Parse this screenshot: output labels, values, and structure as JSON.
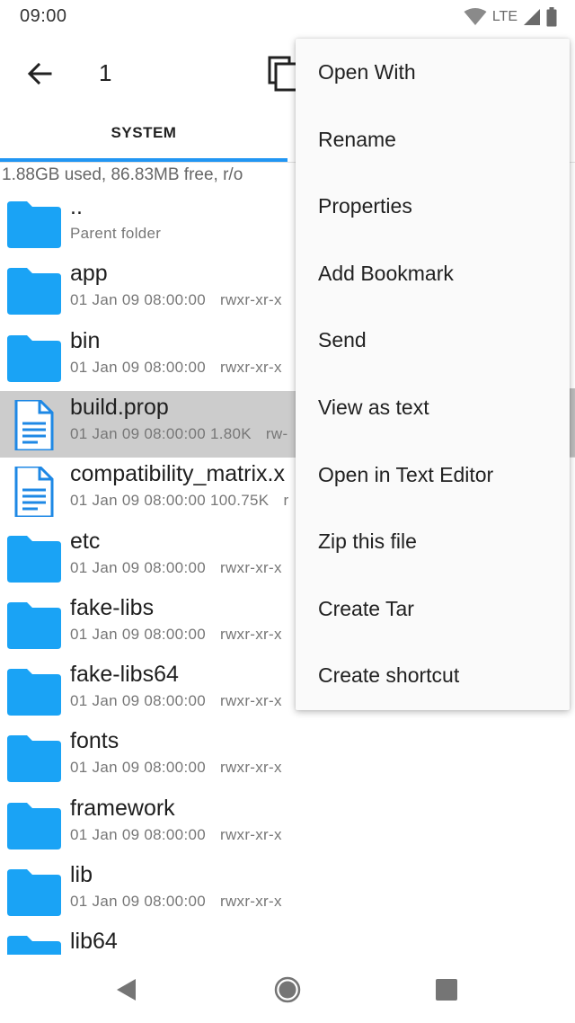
{
  "status_bar": {
    "time": "09:00",
    "network": "LTE",
    "icons": [
      "wifi-icon",
      "cell-signal-icon",
      "battery-icon"
    ]
  },
  "app_bar": {
    "title": "1",
    "back_icon": "arrow-back-icon",
    "copy_icon": "copy-icon"
  },
  "tabs": [
    {
      "label": "SYSTEM",
      "active": true
    }
  ],
  "storage_info": "1.88GB used, 86.83MB free, r/o",
  "colors": {
    "accent": "#2196f3",
    "folder": "#1aa3f5",
    "selected_row": "#cccccc"
  },
  "files": [
    {
      "name": "..",
      "meta": "Parent folder",
      "perm": "",
      "type": "folder",
      "selected": false
    },
    {
      "name": "app",
      "meta": "01 Jan 09 08:00:00",
      "perm": "rwxr-xr-x",
      "type": "folder",
      "selected": false
    },
    {
      "name": "bin",
      "meta": "01 Jan 09 08:00:00",
      "perm": "rwxr-xr-x",
      "type": "folder",
      "selected": false
    },
    {
      "name": "build.prop",
      "meta": "01 Jan 09 08:00:00  1.80K",
      "perm": "rw-",
      "type": "file",
      "selected": true
    },
    {
      "name": "compatibility_matrix.x",
      "meta": "01 Jan 09 08:00:00  100.75K",
      "perm": "r",
      "type": "file",
      "selected": false
    },
    {
      "name": "etc",
      "meta": "01 Jan 09 08:00:00",
      "perm": "rwxr-xr-x",
      "type": "folder",
      "selected": false
    },
    {
      "name": "fake-libs",
      "meta": "01 Jan 09 08:00:00",
      "perm": "rwxr-xr-x",
      "type": "folder",
      "selected": false
    },
    {
      "name": "fake-libs64",
      "meta": "01 Jan 09 08:00:00",
      "perm": "rwxr-xr-x",
      "type": "folder",
      "selected": false
    },
    {
      "name": "fonts",
      "meta": "01 Jan 09 08:00:00",
      "perm": "rwxr-xr-x",
      "type": "folder",
      "selected": false
    },
    {
      "name": "framework",
      "meta": "01 Jan 09 08:00:00",
      "perm": "rwxr-xr-x",
      "type": "folder",
      "selected": false
    },
    {
      "name": "lib",
      "meta": "01 Jan 09 08:00:00",
      "perm": "rwxr-xr-x",
      "type": "folder",
      "selected": false
    },
    {
      "name": "lib64",
      "meta": "",
      "perm": "",
      "type": "folder",
      "selected": false
    }
  ],
  "context_menu": [
    "Open With",
    "Rename",
    "Properties",
    "Add Bookmark",
    "Send",
    "View as text",
    "Open in Text Editor",
    "Zip this file",
    "Create Tar",
    "Create shortcut"
  ],
  "nav_bar": {
    "icons": [
      "back-triangle-icon",
      "home-circle-icon",
      "recents-square-icon"
    ]
  }
}
